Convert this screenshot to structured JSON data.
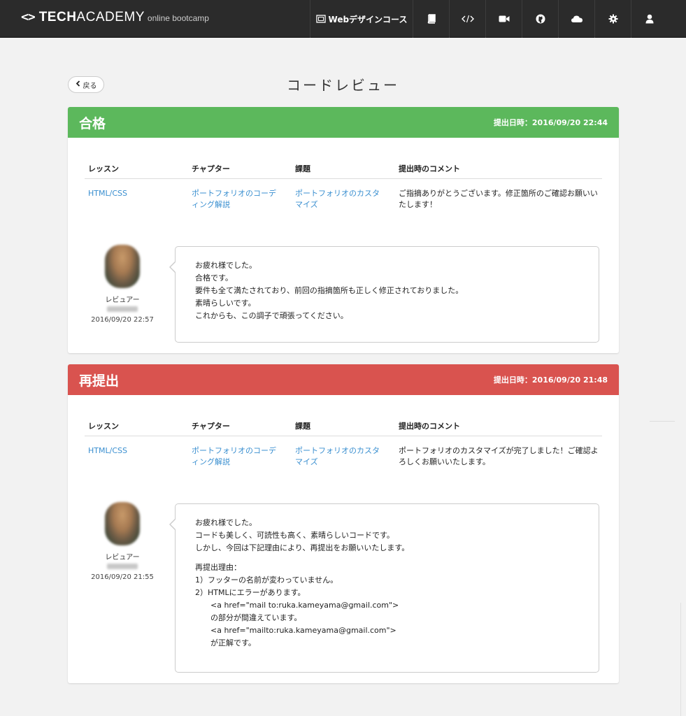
{
  "header": {
    "logo_glyph": "<>",
    "logo_brand_bold": "TECH",
    "logo_brand_light": "ACADEMY",
    "logo_sub": "online bootcamp",
    "course_label": "Webデザインコース",
    "nav_icons": [
      "book-icon",
      "code-icon",
      "video-icon",
      "github-icon",
      "cloud-icon",
      "settings-icon",
      "user-icon"
    ]
  },
  "page": {
    "back_label": "戻る",
    "title": "コードレビュー"
  },
  "table_headers": {
    "lesson": "レッスン",
    "chapter": "チャプター",
    "task": "課題",
    "comment": "提出時のコメント"
  },
  "reviews": [
    {
      "status": "合格",
      "status_color": "#5cb85c",
      "submitted": "提出日時：2016/09/20 22:44",
      "lesson": "HTML/CSS",
      "chapter": "ポートフォリオのコーディング解説",
      "task": "ポートフォリオのカスタマイズ",
      "comment": "ご指摘ありがとうございます。修正箇所のご確認お願いいたします！",
      "reviewer_label": "レビュアー",
      "review_date": "2016/09/20 22:57",
      "message": [
        "お疲れ様でした。",
        "合格です。",
        "要件も全て満たされており、前回の指摘箇所も正しく修正されておりました。",
        "素晴らしいです。",
        "これからも、この調子で頑張ってください。"
      ]
    },
    {
      "status": "再提出",
      "status_color": "#d9534f",
      "submitted": "提出日時：2016/09/20 21:48",
      "lesson": "HTML/CSS",
      "chapter": "ポートフォリオのコーディング解説",
      "task": "ポートフォリオのカスタマイズ",
      "comment": "ポートフォリオのカスタマイズが完了しました！ご確認よろしくお願いいたします。",
      "reviewer_label": "レビュアー",
      "review_date": "2016/09/20 21:55",
      "message": [
        "お疲れ様でした。",
        "コードも美しく、可読性も高く、素晴らしいコードです。",
        "しかし、今回は下記理由により、再提出をお願いいたします。",
        "再提出理由：",
        "1）フッターの名前が変わっていません。",
        "2）HTMLにエラーがあります。",
        "<a href=\"mail to:ruka.kameyama@gmail.com\">",
        "の部分が間違えています。",
        "<a href=\"mailto:ruka.kameyama@gmail.com\">",
        "が正解です。"
      ]
    }
  ]
}
